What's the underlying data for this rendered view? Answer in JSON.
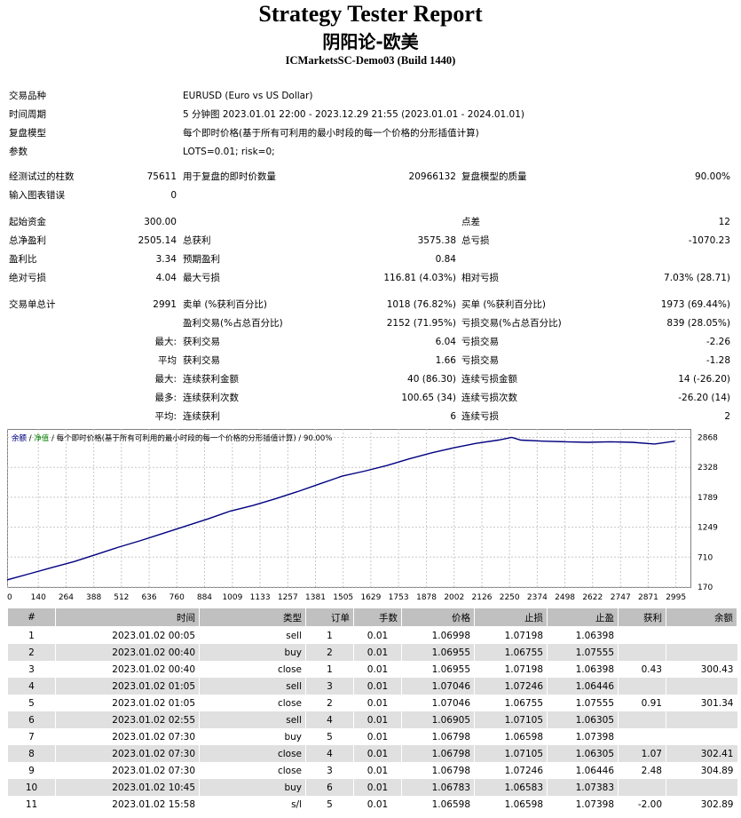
{
  "header": {
    "title": "Strategy Tester Report",
    "ea_name": "阴阳论-欧美",
    "server": "ICMarketsSC-Demo03 (Build 1440)"
  },
  "settings": {
    "symbol_label": "交易品种",
    "symbol": "EURUSD (Euro vs US Dollar)",
    "period_label": "时间周期",
    "period": "5 分钟图 2023.01.01 22:00 - 2023.12.29 21:55 (2023.01.01 - 2024.01.01)",
    "model_label": "复盘模型",
    "model": "每个即时价格(基于所有可利用的最小时段的每一个价格的分形插值计算)",
    "params_label": "参数",
    "params": "LOTS=0.01; risk=0;"
  },
  "stats": {
    "bars_label": "经测试过的柱数",
    "bars": "75611",
    "ticks_label": "用于复盘的即时价数量",
    "ticks": "20966132",
    "quality_label": "复盘模型的质量",
    "quality": "90.00%",
    "errors_label": "输入图表错误",
    "errors": "0",
    "deposit_label": "起始资金",
    "deposit": "300.00",
    "spread_label": "点差",
    "spread": "12",
    "net_label": "总净盈利",
    "net": "2505.14",
    "gross_profit_label": "总获利",
    "gross_profit": "3575.38",
    "gross_loss_label": "总亏损",
    "gross_loss": "-1070.23",
    "pf_label": "盈利比",
    "pf": "3.34",
    "payoff_label": "预期盈利",
    "payoff": "0.84",
    "abs_dd_label": "绝对亏损",
    "abs_dd": "4.04",
    "max_dd_label": "最大亏损",
    "max_dd": "116.81 (4.03%)",
    "rel_dd_label": "相对亏损",
    "rel_dd": "7.03% (28.71)",
    "trades_label": "交易单总计",
    "trades": "2991",
    "short_label": "卖单 (%获利百分比)",
    "short": "1018 (76.82%)",
    "long_label": "买单 (%获利百分比)",
    "long": "1973 (69.44%)",
    "win_label": "盈利交易(%占总百分比)",
    "win": "2152 (71.95%)",
    "loss_label": "亏损交易(%占总百分比)",
    "loss": "839 (28.05%)",
    "max_label": "最大:",
    "avg_label": "平均",
    "max2_label": "最大:",
    "most_label": "最多:",
    "avg2_label": "平均:",
    "largest_win_label": "获利交易",
    "largest_win": "6.04",
    "largest_loss_label": "亏损交易",
    "largest_loss": "-2.26",
    "avg_win_label": "获利交易",
    "avg_win": "1.66",
    "avg_loss_label": "亏损交易",
    "avg_loss": "-1.28",
    "cons_win_amt_label": "连续获利金额",
    "cons_win_amt": "40 (86.30)",
    "cons_loss_amt_label": "连续亏损金额",
    "cons_loss_amt": "14 (-26.20)",
    "cons_win_cnt_label": "连续获利次数",
    "cons_win_cnt": "100.65 (34)",
    "cons_loss_cnt_label": "连续亏损次数",
    "cons_loss_cnt": "-26.20 (14)",
    "avg_cons_win_label": "连续获利",
    "avg_cons_win": "6",
    "avg_cons_loss_label": "连续亏损",
    "avg_cons_loss": "2"
  },
  "chart_data": {
    "type": "line",
    "legend_balance": "余额",
    "legend_sep": "/",
    "legend_equity": "净值",
    "legend_rest": "/ 每个即时价格(基于所有可利用的最小时段的每一个价格的分形插值计算) / 90.00%",
    "x_ticks": [
      0,
      140,
      264,
      388,
      512,
      636,
      760,
      884,
      1009,
      1133,
      1257,
      1381,
      1505,
      1629,
      1753,
      1878,
      2002,
      2126,
      2250,
      2374,
      2498,
      2622,
      2747,
      2871,
      2995
    ],
    "y_ticks": [
      2868,
      2328,
      1789,
      1249,
      710,
      170
    ],
    "xlim": [
      0,
      3060
    ],
    "ylim": [
      170,
      3020
    ],
    "series": [
      {
        "x": [
          0,
          100,
          200,
          300,
          400,
          500,
          600,
          700,
          800,
          900,
          1000,
          1100,
          1200,
          1300,
          1400,
          1500,
          1600,
          1700,
          1800,
          1900,
          2000,
          2100,
          2200,
          2260,
          2300,
          2400,
          2500,
          2600,
          2700,
          2800,
          2900,
          2991
        ],
        "values": [
          300,
          410,
          520,
          630,
          760,
          890,
          1010,
          1140,
          1270,
          1400,
          1540,
          1640,
          1760,
          1890,
          2030,
          2170,
          2260,
          2360,
          2480,
          2590,
          2680,
          2760,
          2820,
          2868,
          2820,
          2800,
          2790,
          2780,
          2790,
          2780,
          2750,
          2800
        ]
      }
    ],
    "colors": {
      "line": "#000080",
      "grid": "#c8c8c8",
      "balance_legend": "#000080",
      "equity_legend": "#008000"
    }
  },
  "deals": {
    "headers": [
      "#",
      "时间",
      "类型",
      "订单",
      "手数",
      "价格",
      "止损",
      "止盈",
      "获利",
      "余额"
    ],
    "rows": [
      [
        "1",
        "2023.01.02 00:05",
        "sell",
        "1",
        "0.01",
        "1.06998",
        "1.07198",
        "1.06398",
        "",
        ""
      ],
      [
        "2",
        "2023.01.02 00:40",
        "buy",
        "2",
        "0.01",
        "1.06955",
        "1.06755",
        "1.07555",
        "",
        ""
      ],
      [
        "3",
        "2023.01.02 00:40",
        "close",
        "1",
        "0.01",
        "1.06955",
        "1.07198",
        "1.06398",
        "0.43",
        "300.43"
      ],
      [
        "4",
        "2023.01.02 01:05",
        "sell",
        "3",
        "0.01",
        "1.07046",
        "1.07246",
        "1.06446",
        "",
        ""
      ],
      [
        "5",
        "2023.01.02 01:05",
        "close",
        "2",
        "0.01",
        "1.07046",
        "1.06755",
        "1.07555",
        "0.91",
        "301.34"
      ],
      [
        "6",
        "2023.01.02 02:55",
        "sell",
        "4",
        "0.01",
        "1.06905",
        "1.07105",
        "1.06305",
        "",
        ""
      ],
      [
        "7",
        "2023.01.02 07:30",
        "buy",
        "5",
        "0.01",
        "1.06798",
        "1.06598",
        "1.07398",
        "",
        ""
      ],
      [
        "8",
        "2023.01.02 07:30",
        "close",
        "4",
        "0.01",
        "1.06798",
        "1.07105",
        "1.06305",
        "1.07",
        "302.41"
      ],
      [
        "9",
        "2023.01.02 07:30",
        "close",
        "3",
        "0.01",
        "1.06798",
        "1.07246",
        "1.06446",
        "2.48",
        "304.89"
      ],
      [
        "10",
        "2023.01.02 10:45",
        "buy",
        "6",
        "0.01",
        "1.06783",
        "1.06583",
        "1.07383",
        "",
        ""
      ],
      [
        "11",
        "2023.01.02 15:58",
        "s/l",
        "5",
        "0.01",
        "1.06598",
        "1.06598",
        "1.07398",
        "-2.00",
        "302.89"
      ]
    ]
  }
}
